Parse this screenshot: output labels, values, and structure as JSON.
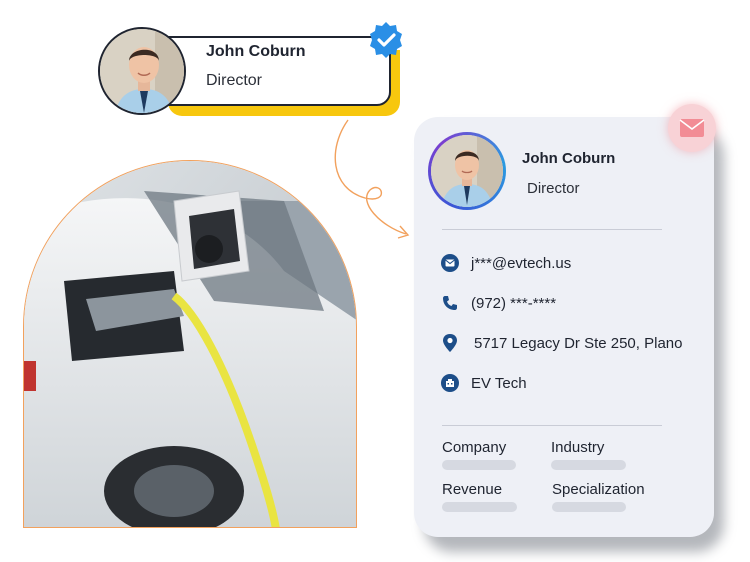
{
  "badge": {
    "name": "John Coburn",
    "role": "Director",
    "verified_icon": "verified-check-icon"
  },
  "photo": {
    "description_icon": "ev-charging-photo"
  },
  "card": {
    "name": "John Coburn",
    "role": "Director",
    "contacts": [
      {
        "icon": "email-icon",
        "text": "j***@evtech.us"
      },
      {
        "icon": "phone-icon",
        "text": "(972) ***-****"
      },
      {
        "icon": "location-pin-icon",
        "text": "5717 Legacy Dr Ste 250, Plano"
      },
      {
        "icon": "company-icon",
        "text": "EV Tech"
      }
    ],
    "fields": [
      "Company",
      "Industry",
      "Revenue",
      "Specialization"
    ],
    "mail_icon": "envelope-icon"
  },
  "colors": {
    "accent_yellow": "#f7c70e",
    "verified_blue": "#2a8fe6",
    "icon_blue": "#1d4e89",
    "card_bg": "#eef0f6",
    "photo_border": "#f2a15d",
    "mail_badge": "#f8d2d6"
  }
}
